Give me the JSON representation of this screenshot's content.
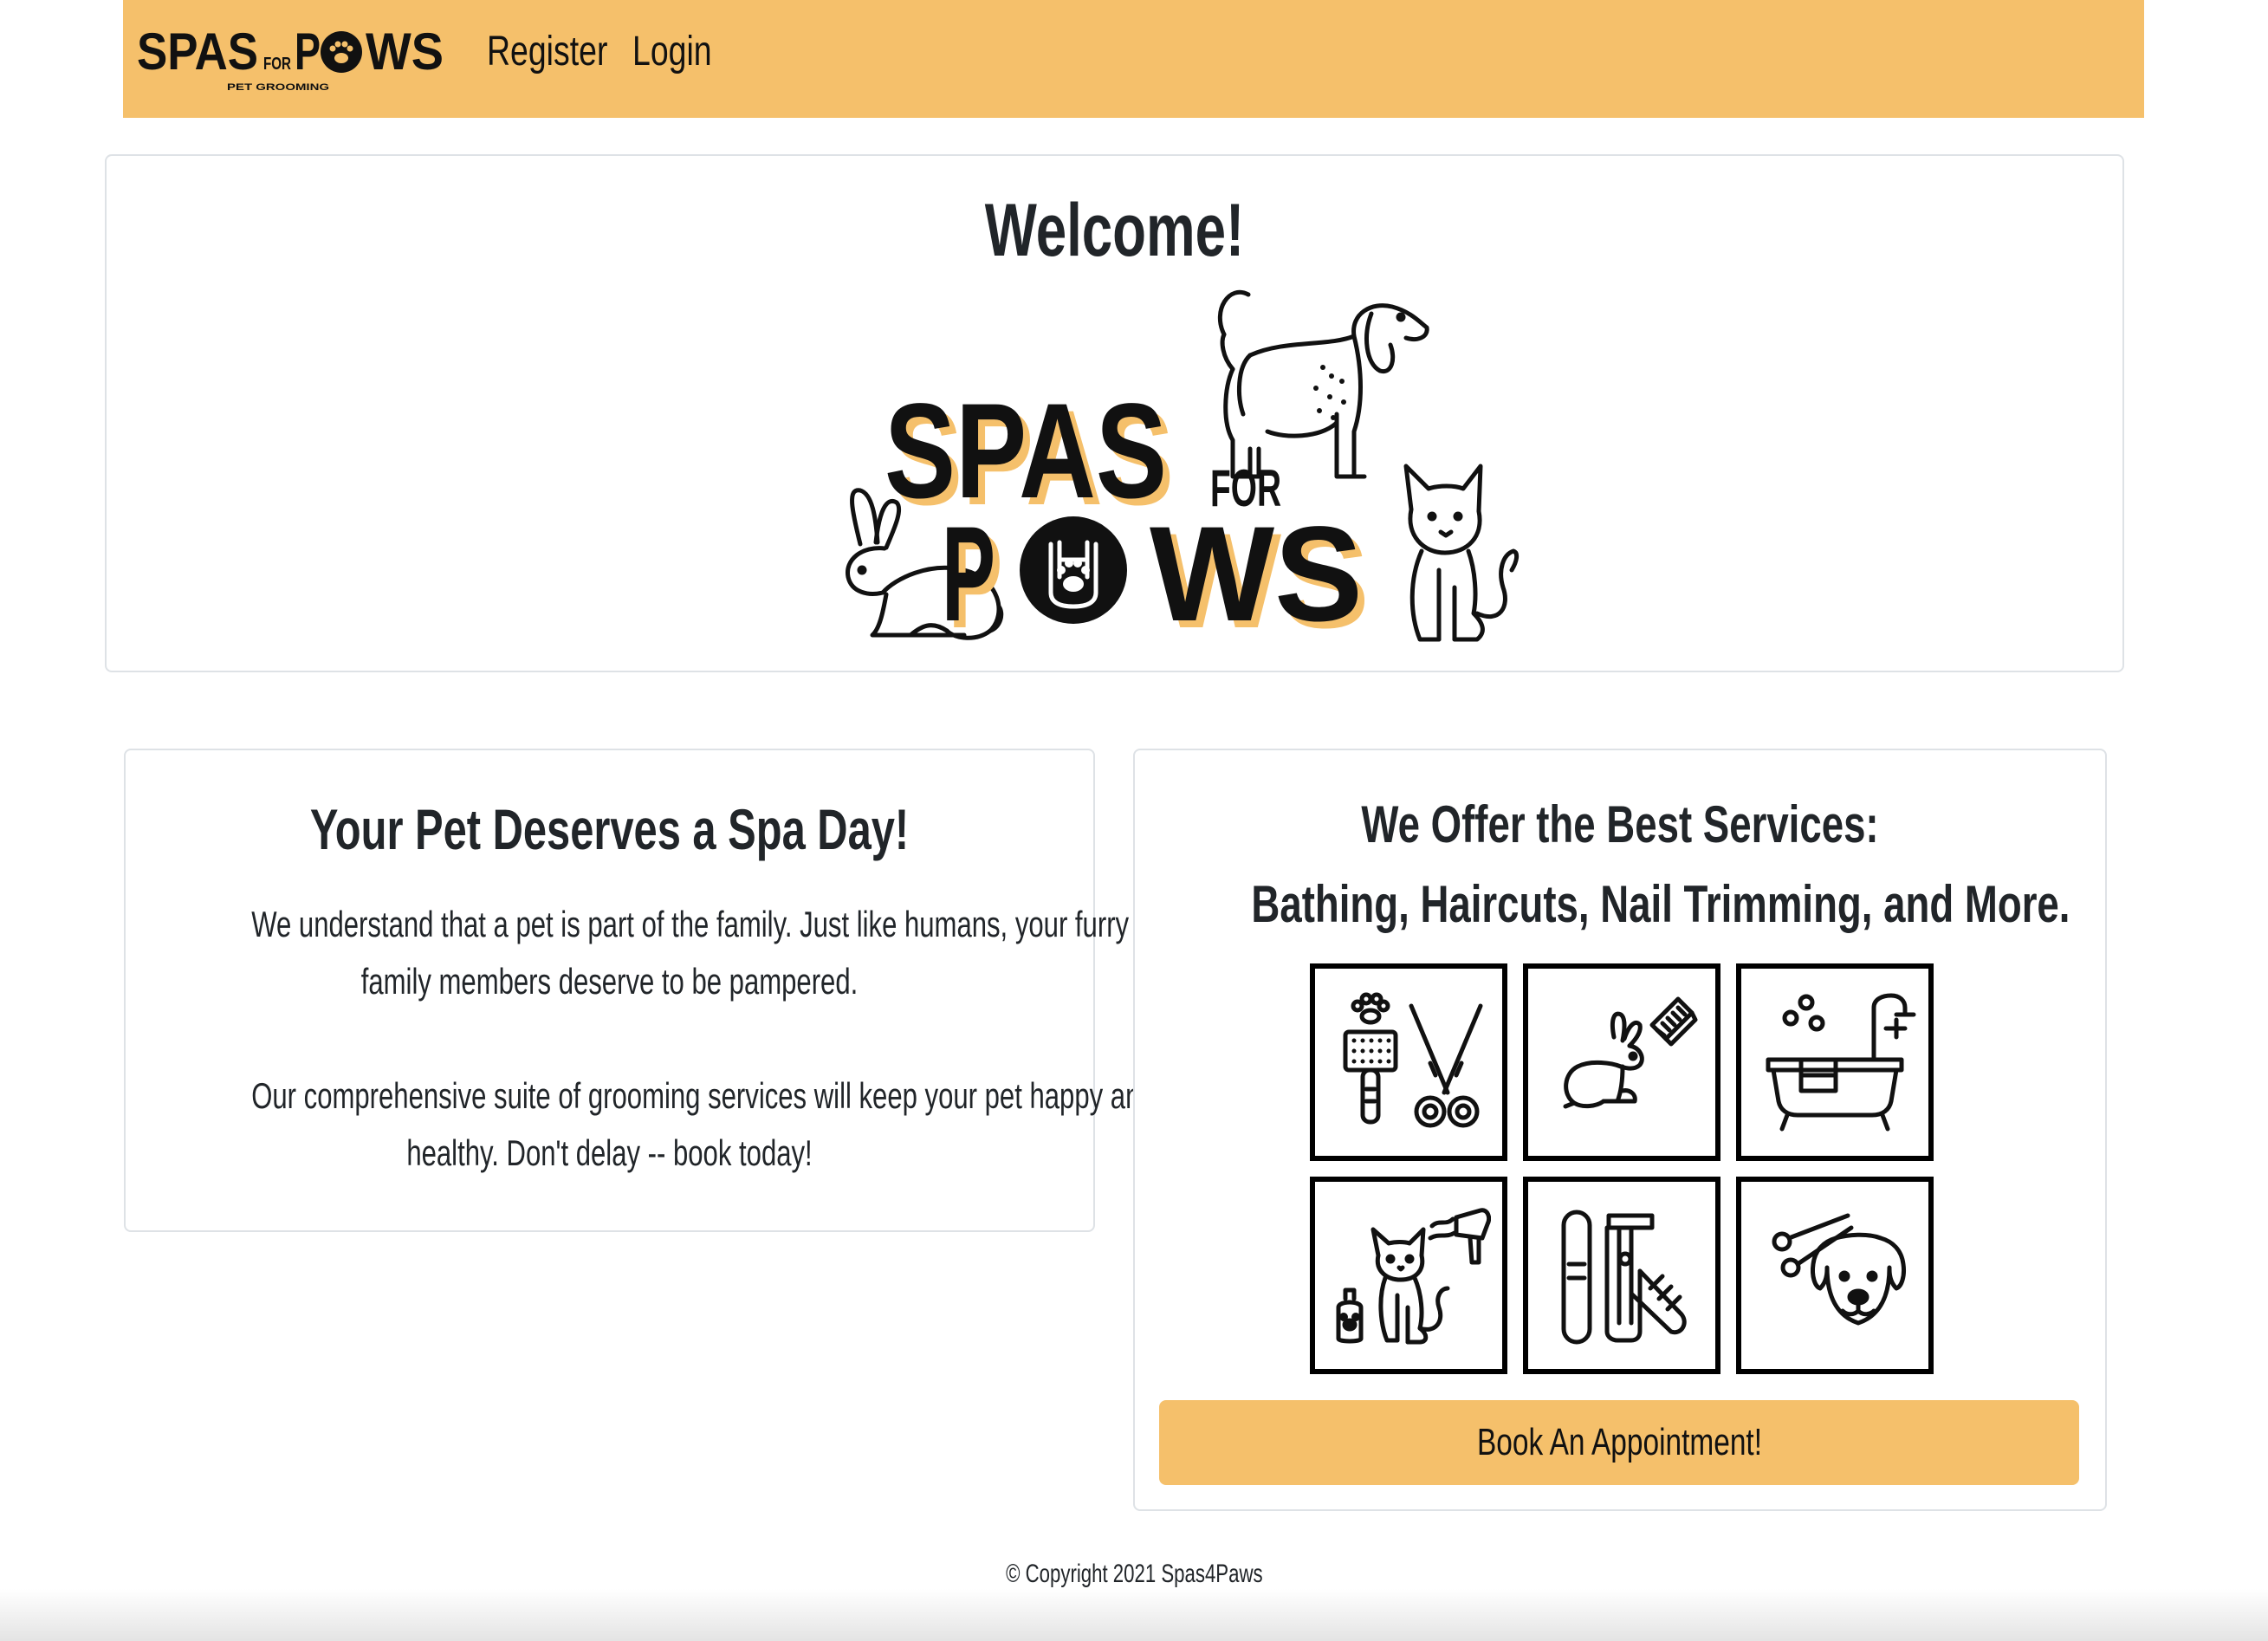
{
  "navbar": {
    "brand_alt": "Spas for Paws Pet Grooming",
    "brand_word_1": "SPAS",
    "brand_word_for": "FOR",
    "brand_word_2": "P",
    "brand_word_3": "WS",
    "brand_sub": "PET GROOMING",
    "links": [
      {
        "label": "Register"
      },
      {
        "label": "Login"
      }
    ],
    "accent_color": "#f5c06b"
  },
  "welcome": {
    "title": "Welcome!",
    "logo": {
      "word_1": "SPAS",
      "word_for": "FOR",
      "word_2": "P",
      "word_3": "WS"
    }
  },
  "about": {
    "title": "Your Pet Deserves a Spa Day!",
    "paragraph_1_line_1": "We understand that a pet is part of the family. Just like humans, your furry",
    "paragraph_1_line_2": "family members deserve to be pampered.",
    "paragraph_2_line_1": "Our comprehensive suite of grooming services will keep your pet happy and",
    "paragraph_2_line_2": "healthy. Don't delay -- book today!"
  },
  "services": {
    "title_line_1": "We Offer the Best Services:",
    "title_line_2": "Bathing, Haircuts, Nail Trimming, and More.",
    "icons": [
      "brush-scissors-icon",
      "rabbit-comb-icon",
      "bathtub-icon",
      "cat-dryer-icon",
      "nail-clipper-icon",
      "dog-scissors-icon"
    ],
    "cta_label": "Book An Appointment!"
  },
  "footer": {
    "copyright": "© Copyright 2021 Spas4Paws"
  }
}
